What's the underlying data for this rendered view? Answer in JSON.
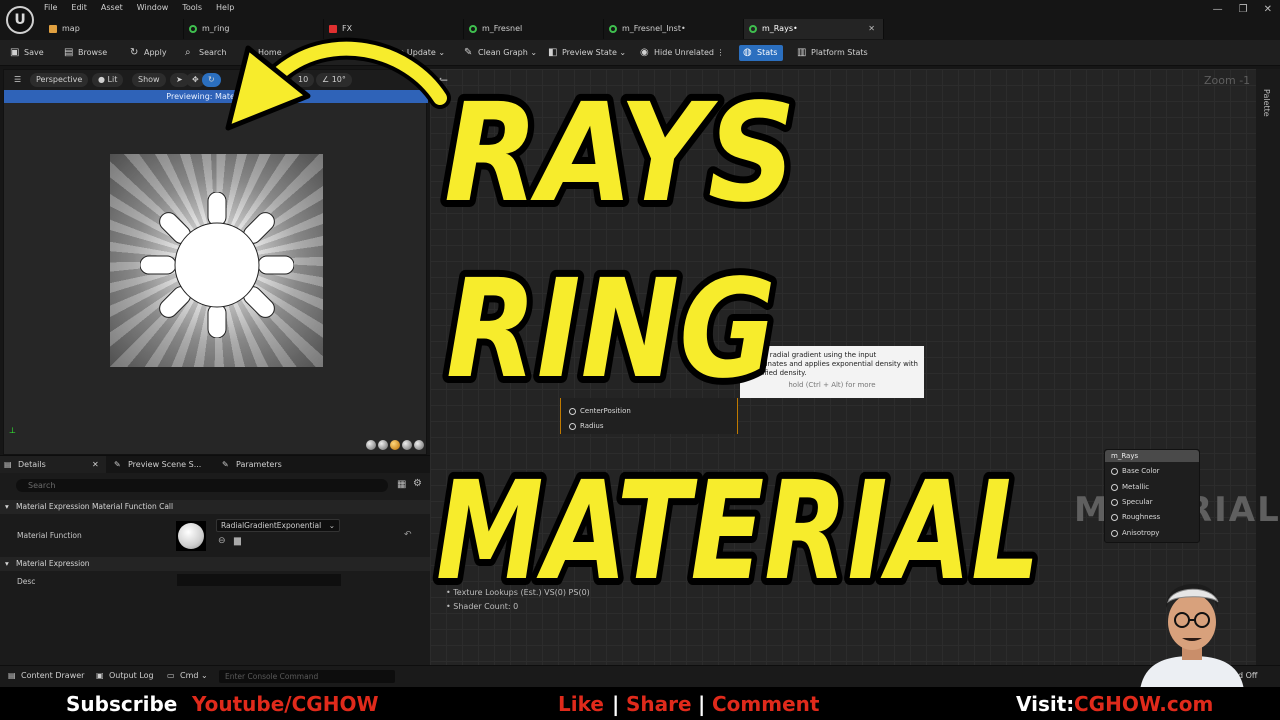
{
  "menu": [
    "File",
    "Edit",
    "Asset",
    "Window",
    "Tools",
    "Help"
  ],
  "tabs": [
    {
      "label": "map",
      "color": "#e0a040",
      "active": false
    },
    {
      "label": "m_ring",
      "color": "#3fbf4f",
      "active": false
    },
    {
      "label": "FX",
      "color": "#e03030",
      "active": false
    },
    {
      "label": "m_Fresnel",
      "color": "#3fbf4f",
      "active": false
    },
    {
      "label": "m_Fresnel_Inst•",
      "color": "#3fbf4f",
      "active": false
    },
    {
      "label": "m_Rays•",
      "color": "#3fbf4f",
      "active": true
    }
  ],
  "toolbar": {
    "save": "Save",
    "browse": "Browse",
    "apply": "Apply",
    "search": "Search",
    "home": "Home",
    "live_update": "Live Update",
    "clean_graph": "Clean Graph",
    "preview_state": "Preview State",
    "hide_unrelated": "Hide Unrelated",
    "stats": "Stats",
    "platform_stats": "Platform Stats"
  },
  "viewport": {
    "perspective": "Perspective",
    "lit": "Lit",
    "show": "Show",
    "fov": "10",
    "angle": "10°",
    "preview_banner": "Previewing: MaterialExpr"
  },
  "details": {
    "tabs": [
      "Details",
      "Preview Scene S...",
      "Parameters"
    ],
    "search_placeholder": "Search",
    "section_function_call": "Material Expression Material Function Call",
    "material_function_label": "Material Function",
    "material_function_value": "RadialGradientExponential",
    "section_expression": "Material Expression",
    "desc_label": "Desc"
  },
  "graph": {
    "zoom": "Zoom -1",
    "palette": "Palette",
    "tooltip_text": "ates a radial gradient using the input coordinates and applies exponential density with specified density.",
    "tooltip_hint": "hold (Ctrl + Alt) for more",
    "node_pins": [
      "CenterPosition",
      "Radius"
    ],
    "material_node_title": "m_Rays",
    "material_pins": [
      "Base Color",
      "Metallic",
      "Specular",
      "Roughness",
      "Anisotropy"
    ],
    "watermark": "MATERIAL",
    "stats_line1": "Texture Lookups (Est.) VS(0) PS(0)",
    "stats_line2": "Shader Count: 0"
  },
  "bottombar": {
    "content_drawer": "Content Drawer",
    "output_log": "Output Log",
    "cmd": "Cmd",
    "console_placeholder": "Enter Console Command",
    "revision": "d Off"
  },
  "overlay": {
    "line1": "RAYS",
    "line2": "RING",
    "line3": "MATERIAL",
    "fill_color": "#f7ec2c",
    "outline_color": "#000000"
  },
  "banner": {
    "subscribe": "Subscribe",
    "youtube": "Youtube/CGHOW",
    "like": "Like",
    "sep": "|",
    "share": "Share",
    "comment": "Comment",
    "visit": "Visit:",
    "site": "CGHOW.com",
    "white": "#ffffff",
    "red": "#e02a1b"
  }
}
